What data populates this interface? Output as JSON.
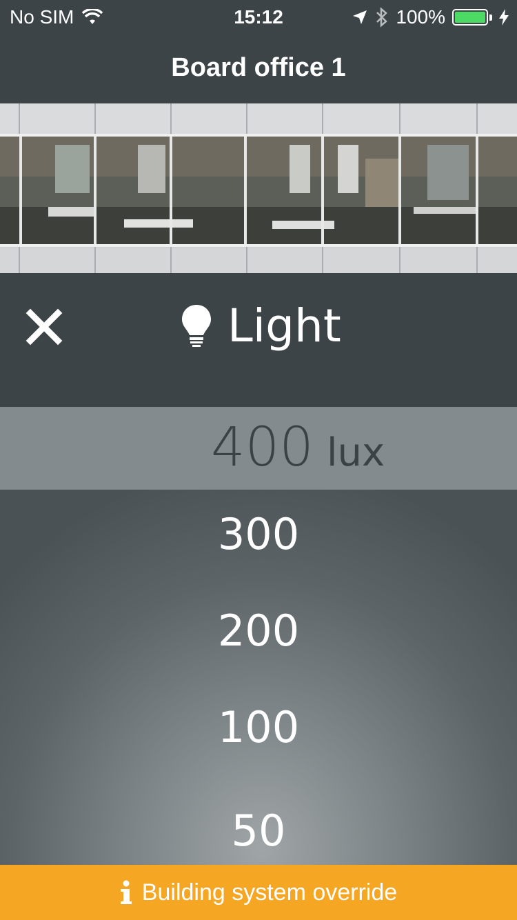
{
  "status_bar": {
    "carrier": "No SIM",
    "time": "15:12",
    "battery": "100%"
  },
  "nav": {
    "title": "Board office 1"
  },
  "control": {
    "title": "Light",
    "close_icon": "close-icon",
    "title_icon": "lightbulb-icon"
  },
  "picker": {
    "selected_value": "400",
    "unit": "lux",
    "options": [
      "300",
      "200",
      "100",
      "50"
    ]
  },
  "override": {
    "icon": "info-icon",
    "label": "Building system override"
  },
  "colors": {
    "header_bg": "#3c4448",
    "override_bg": "#f5a623",
    "battery_fill": "#4cd964"
  }
}
